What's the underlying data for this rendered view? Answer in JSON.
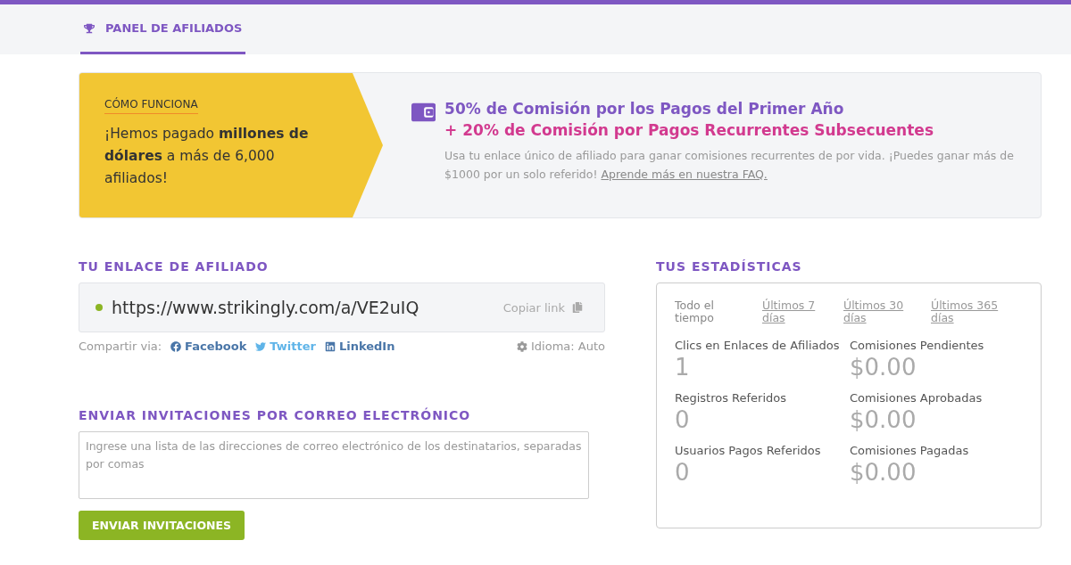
{
  "tabs": [
    {
      "label": "PANEL DE AFILIADOS",
      "selected": true
    }
  ],
  "banner": {
    "eyebrow": "CÓMO FUNCIONA",
    "text": "¡Hemos pagado **millones de dólares** a más de 6,000 afiliados!",
    "headline_1": "50% de Comisión por los Pagos del Primer Año",
    "headline_2": "+ 20% de Comisión por Pagos Recurrentes Subsecuentes",
    "body": "Usa tu enlace único de afiliado para ganar comisiones recurrentes de por vida. ¡Puedes ganar más de $1000 por un solo referido!",
    "link": "Aprende más en nuestra FAQ."
  },
  "affiliate_link": {
    "heading": "TU ENLACE DE AFILIADO",
    "url": "https://www.strikingly.com/a/VE2uIQ",
    "copy": "Copiar link",
    "share_label": "Compartir via:",
    "share": [
      {
        "kind": "facebook",
        "label": "Facebook"
      },
      {
        "kind": "twitter",
        "label": "Twitter"
      },
      {
        "kind": "linkedin",
        "label": "LinkedIn"
      }
    ],
    "language": "Idioma: Auto"
  },
  "invites": {
    "heading": "ENVIAR INVITACIONES POR CORREO ELECTRÓNICO",
    "placeholder": "Ingrese una lista de las direcciones de correo electrónico de los destinatarios, separadas por comas",
    "button": "ENVIAR INVITACIONES"
  },
  "stats": {
    "heading": "TUS ESTADÍSTICAS",
    "periods": [
      {
        "label": "Todo el tiempo",
        "selected": true
      },
      {
        "label": "Últimos 7 días",
        "selected": false
      },
      {
        "label": "Últimos 30 días",
        "selected": false
      },
      {
        "label": "Últimos 365 días",
        "selected": false
      }
    ],
    "items": [
      {
        "label": "Clics en Enlaces de Afiliados",
        "value": "1"
      },
      {
        "label": "Comisiones Pendientes",
        "value": "$0.00"
      },
      {
        "label": "Registros Referidos",
        "value": "0"
      },
      {
        "label": "Comisiones Aprobadas",
        "value": "$0.00"
      },
      {
        "label": "Usuarios Pagos Referidos",
        "value": "0"
      },
      {
        "label": "Comisiones Pagadas",
        "value": "$0.00"
      }
    ]
  }
}
